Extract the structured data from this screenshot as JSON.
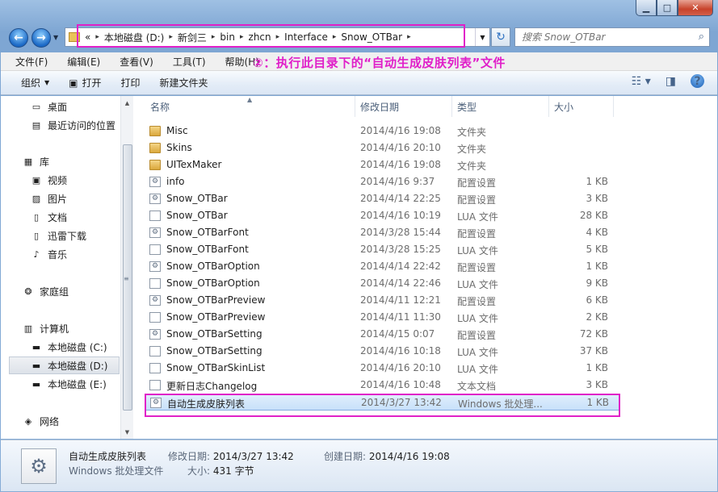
{
  "window": {
    "min_icon": "minimize-icon",
    "max_icon": "maximize-icon",
    "close_icon": "close-icon"
  },
  "address": {
    "prefix": "«",
    "crumbs": [
      "本地磁盘 (D:)",
      "新剑三",
      "bin",
      "zhcn",
      "Interface",
      "Snow_OTBar"
    ],
    "separator": "▸"
  },
  "search": {
    "placeholder": "搜索 Snow_OTBar"
  },
  "menu": [
    "文件(F)",
    "编辑(E)",
    "查看(V)",
    "工具(T)",
    "帮助(H)"
  ],
  "annotation": "②：执行此目录下的“自动生成皮肤列表”文件",
  "toolbar": {
    "organize": "组织",
    "open": "打开",
    "print": "打印",
    "new_folder": "新建文件夹"
  },
  "nav": {
    "items": [
      {
        "label": "桌面",
        "icon": "desktop-icon"
      },
      {
        "label": "最近访问的位置",
        "icon": "recent-places-icon"
      },
      {
        "label": "库",
        "icon": "library-icon"
      },
      {
        "label": "视频",
        "icon": "video-icon"
      },
      {
        "label": "图片",
        "icon": "pictures-icon"
      },
      {
        "label": "文档",
        "icon": "documents-icon"
      },
      {
        "label": "迅雷下载",
        "icon": "thunder-download-icon"
      },
      {
        "label": "音乐",
        "icon": "music-icon"
      },
      {
        "label": "家庭组",
        "icon": "homegroup-icon"
      },
      {
        "label": "计算机",
        "icon": "computer-icon"
      },
      {
        "label": "本地磁盘 (C:)",
        "icon": "drive-c-icon"
      },
      {
        "label": "本地磁盘 (D:)",
        "icon": "drive-d-icon"
      },
      {
        "label": "本地磁盘 (E:)",
        "icon": "drive-e-icon"
      },
      {
        "label": "网络",
        "icon": "network-icon"
      }
    ]
  },
  "columns": {
    "name": "名称",
    "date": "修改日期",
    "type": "类型",
    "size": "大小"
  },
  "files": [
    {
      "name": "Misc",
      "date": "2014/4/16 19:08",
      "type": "文件夹",
      "size": "",
      "icon": "folder"
    },
    {
      "name": "Skins",
      "date": "2014/4/16 20:10",
      "type": "文件夹",
      "size": "",
      "icon": "folder"
    },
    {
      "name": "UITexMaker",
      "date": "2014/4/16 19:08",
      "type": "文件夹",
      "size": "",
      "icon": "folder"
    },
    {
      "name": "info",
      "date": "2014/4/16 9:37",
      "type": "配置设置",
      "size": "1 KB",
      "icon": "cfg"
    },
    {
      "name": "Snow_OTBar",
      "date": "2014/4/14 22:25",
      "type": "配置设置",
      "size": "3 KB",
      "icon": "cfg"
    },
    {
      "name": "Snow_OTBar",
      "date": "2014/4/16 10:19",
      "type": "LUA 文件",
      "size": "28 KB",
      "icon": "doc"
    },
    {
      "name": "Snow_OTBarFont",
      "date": "2014/3/28 15:44",
      "type": "配置设置",
      "size": "4 KB",
      "icon": "cfg"
    },
    {
      "name": "Snow_OTBarFont",
      "date": "2014/3/28 15:25",
      "type": "LUA 文件",
      "size": "5 KB",
      "icon": "doc"
    },
    {
      "name": "Snow_OTBarOption",
      "date": "2014/4/14 22:42",
      "type": "配置设置",
      "size": "1 KB",
      "icon": "cfg"
    },
    {
      "name": "Snow_OTBarOption",
      "date": "2014/4/14 22:46",
      "type": "LUA 文件",
      "size": "9 KB",
      "icon": "doc"
    },
    {
      "name": "Snow_OTBarPreview",
      "date": "2014/4/11 12:21",
      "type": "配置设置",
      "size": "6 KB",
      "icon": "cfg"
    },
    {
      "name": "Snow_OTBarPreview",
      "date": "2014/4/11 11:30",
      "type": "LUA 文件",
      "size": "2 KB",
      "icon": "doc"
    },
    {
      "name": "Snow_OTBarSetting",
      "date": "2014/4/15 0:07",
      "type": "配置设置",
      "size": "72 KB",
      "icon": "cfg"
    },
    {
      "name": "Snow_OTBarSetting",
      "date": "2014/4/16 10:18",
      "type": "LUA 文件",
      "size": "37 KB",
      "icon": "doc"
    },
    {
      "name": "Snow_OTBarSkinList",
      "date": "2014/4/16 20:10",
      "type": "LUA 文件",
      "size": "1 KB",
      "icon": "doc"
    },
    {
      "name": "更新日志Changelog",
      "date": "2014/4/16 10:48",
      "type": "文本文档",
      "size": "3 KB",
      "icon": "doc"
    },
    {
      "name": "自动生成皮肤列表",
      "date": "2014/3/27 13:42",
      "type": "Windows 批处理...",
      "size": "1 KB",
      "icon": "cfg",
      "selected": true
    }
  ],
  "details": {
    "name": "自动生成皮肤列表",
    "type": "Windows 批处理文件",
    "modified_label": "修改日期:",
    "modified": "2014/3/27 13:42",
    "created_label": "创建日期:",
    "created": "2014/4/16 19:08",
    "size_label": "大小:",
    "size": "431 字节"
  },
  "colors": {
    "annotation": "#e021c8",
    "selection": "#c7e0fa"
  }
}
